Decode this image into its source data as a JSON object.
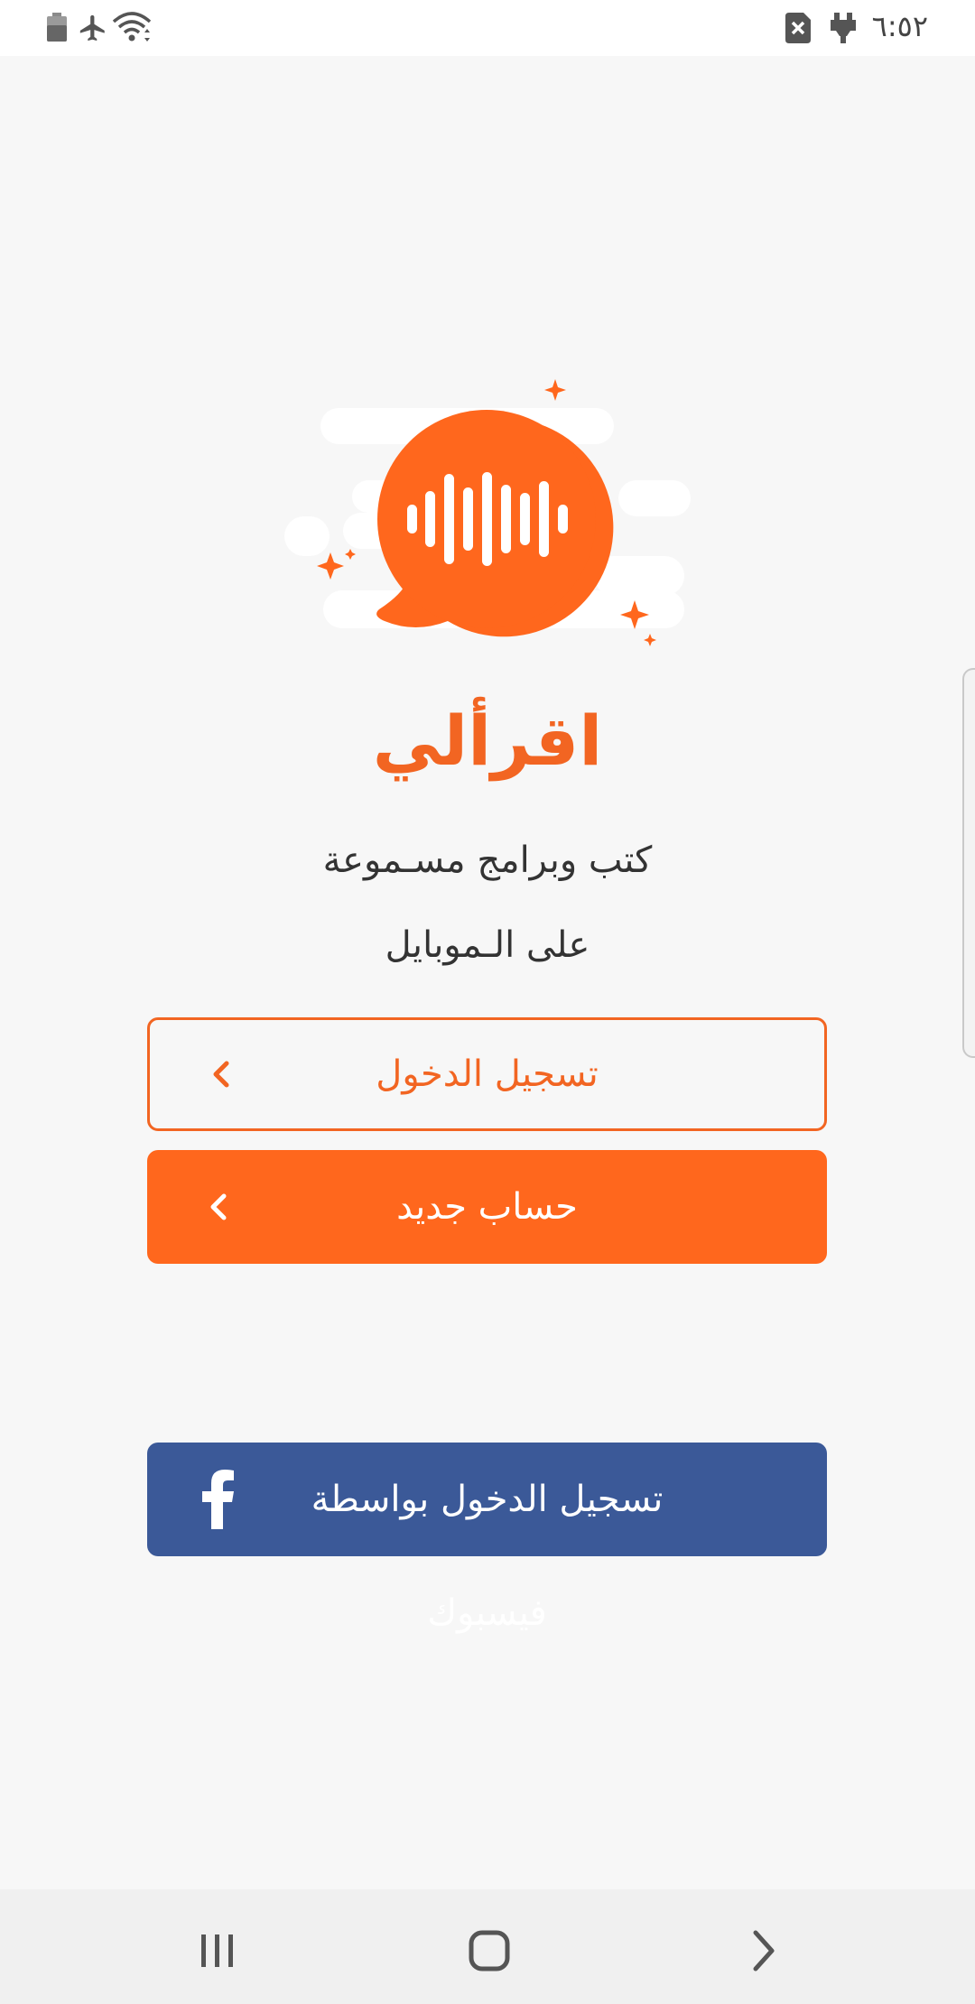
{
  "status_bar": {
    "time": "٦:٥٢",
    "icons": [
      "battery-icon",
      "airplane-mode-icon",
      "wifi-icon",
      "sim-error-icon",
      "usb-icon"
    ]
  },
  "app": {
    "name": "اقرألي",
    "tagline_line1": "كتب وبرامج مسـموعة",
    "tagline_line2": "على الـموبايل"
  },
  "buttons": {
    "login_label": "تسجيل الدخول",
    "signup_label": "حساب جديد",
    "facebook_label": "تسجيل الدخول بواسطة فيسبوك"
  },
  "nav_bar": {
    "icons": [
      "recent-apps-icon",
      "home-icon",
      "back-icon"
    ]
  },
  "colors": {
    "accent": "#ff671d",
    "accent_text": "#f26522",
    "facebook": "#3b5998",
    "background": "#f7f7f7"
  }
}
